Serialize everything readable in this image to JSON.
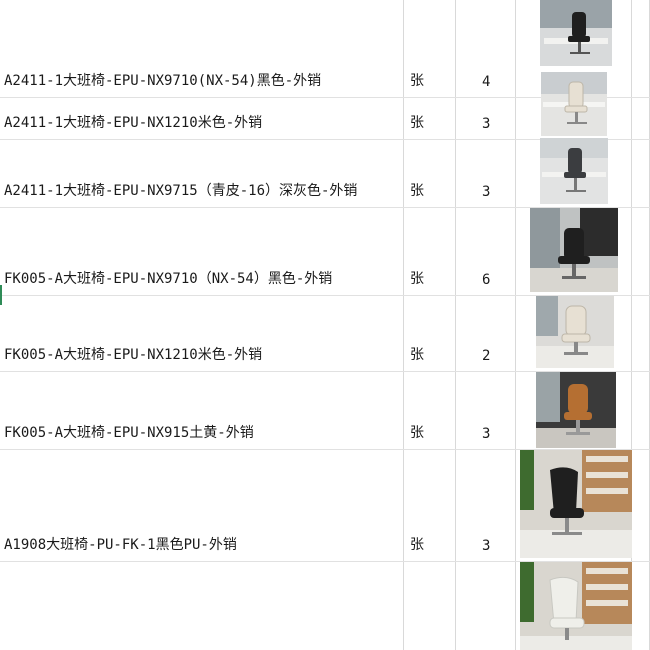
{
  "rows": [
    {
      "name": "A2411-1大班椅-EPU-NX9710(NX-54)黑色-外销",
      "unit": "张",
      "qty": "4",
      "chair_icon": "office-chair-black-icon"
    },
    {
      "name": "A2411-1大班椅-EPU-NX1210米色-外销",
      "unit": "张",
      "qty": "3",
      "chair_icon": "office-chair-beige-icon"
    },
    {
      "name": "A2411-1大班椅-EPU-NX9715（青皮-16）深灰色-外销",
      "unit": "张",
      "qty": "3",
      "chair_icon": "office-chair-darkgray-icon"
    },
    {
      "name": "FK005-A大班椅-EPU-NX9710（NX-54）黑色-外销",
      "unit": "张",
      "qty": "6",
      "chair_icon": "office-chair-black-icon"
    },
    {
      "name": "FK005-A大班椅-EPU-NX1210米色-外销",
      "unit": "张",
      "qty": "2",
      "chair_icon": "office-chair-beige-icon"
    },
    {
      "name": "FK005-A大班椅-EPU-NX915土黄-外销",
      "unit": "张",
      "qty": "3",
      "chair_icon": "office-chair-tan-icon"
    },
    {
      "name": "A1908大班椅-PU-FK-1黑色PU-外销",
      "unit": "张",
      "qty": "3",
      "chair_icon": "lounge-chair-black-icon"
    },
    {
      "name": "",
      "unit": "",
      "qty": "",
      "chair_icon": "lounge-chair-white-icon"
    }
  ],
  "colors": {
    "black_leather": "#1f1f1f",
    "beige_leather": "#e7e0d3",
    "darkgray_leather": "#3b3d40",
    "tan_leather": "#b56f32",
    "white_leather": "#efefea",
    "grid": "#d9d9d9"
  }
}
